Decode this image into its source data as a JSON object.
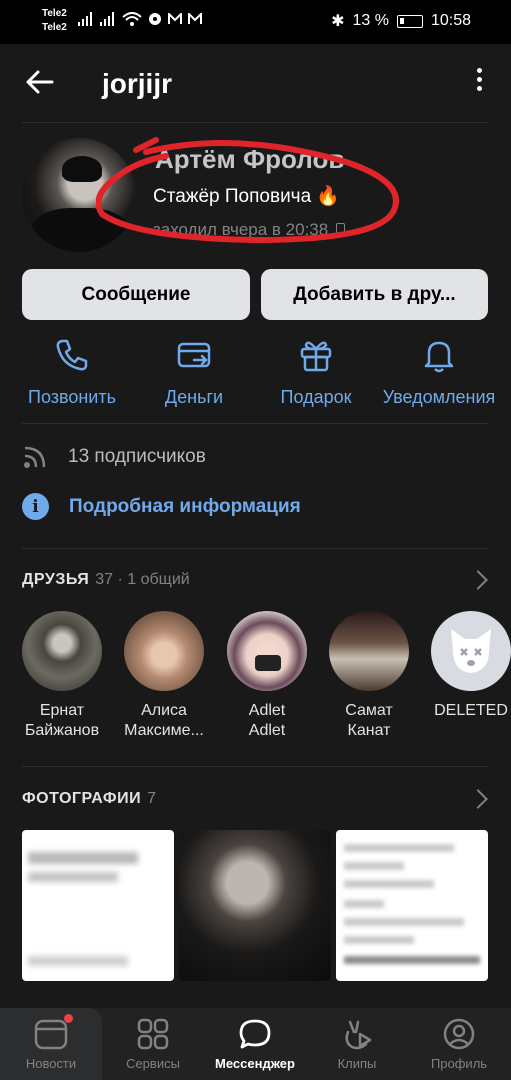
{
  "statusbar": {
    "carrier1": "Tele2",
    "carrier2": "Tele2",
    "battery": "13 %",
    "time": "10:58"
  },
  "appbar": {
    "title": "jorjijr"
  },
  "profile": {
    "name": "Артём Фролов",
    "status": "Стажёр Поповича 🔥",
    "last_seen": "заходил вчера в 20:38"
  },
  "buttons": {
    "message": "Сообщение",
    "add_friend": "Добавить в дру..."
  },
  "actions": {
    "call": "Позвонить",
    "money": "Деньги",
    "gift": "Подарок",
    "notifications": "Уведомления"
  },
  "info": {
    "subscribers": "13 подписчиков",
    "details": "Подробная информация"
  },
  "friends": {
    "title": "ДРУЗЬЯ",
    "count": "37 · 1 общий",
    "items": [
      {
        "line1": "Ернат",
        "line2": "Байжанов"
      },
      {
        "line1": "Алиса",
        "line2": "Максиме..."
      },
      {
        "line1": "Adlet",
        "line2": "Adlet"
      },
      {
        "line1": "Самат",
        "line2": "Канат"
      },
      {
        "line1": "DELETED",
        "line2": ""
      }
    ]
  },
  "photos": {
    "title": "ФОТОГРАФИИ",
    "count": "7"
  },
  "nav": {
    "news": "Новости",
    "services": "Сервисы",
    "messenger": "Мессенджер",
    "clips": "Клипы",
    "profile": "Профиль"
  },
  "colors": {
    "background": "#19191a",
    "accent": "#71aaeb",
    "annotation_red": "#e0252a"
  }
}
